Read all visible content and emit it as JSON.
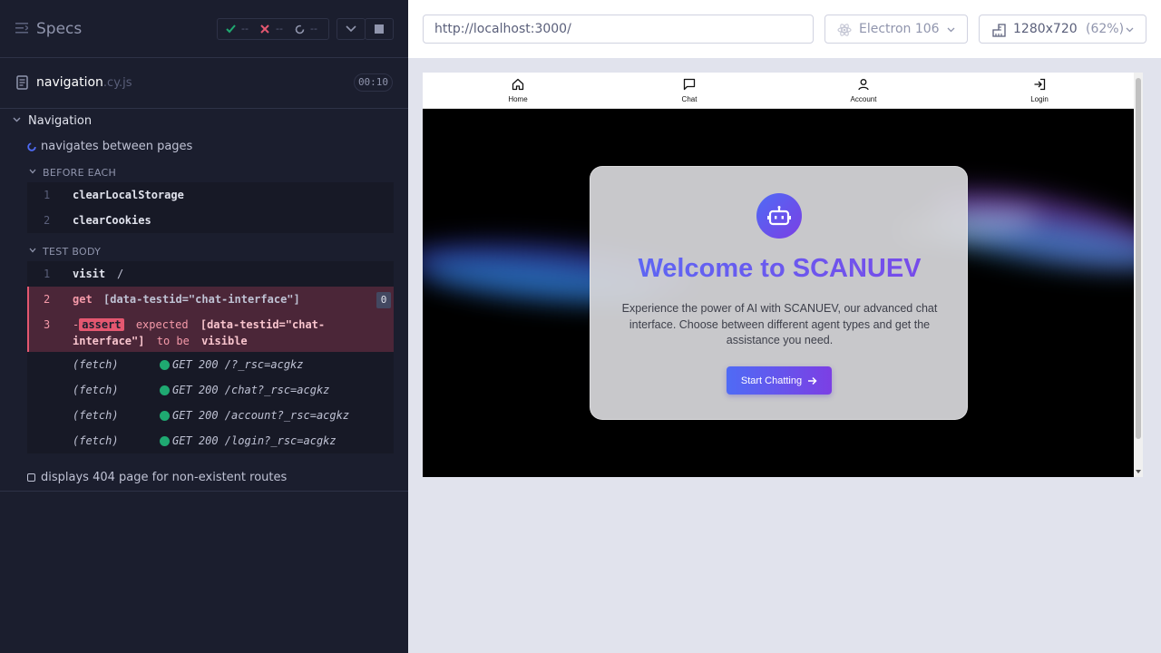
{
  "reporter": {
    "header": {
      "title": "Specs"
    },
    "stats": {
      "passed": "--",
      "failed": "--",
      "pending": "--"
    },
    "file": {
      "name": "navigation",
      "ext": ".cy.js",
      "duration": "00:10"
    },
    "suite": {
      "title": "Navigation"
    },
    "tests": [
      {
        "title": "navigates between pages",
        "state": "running"
      },
      {
        "title": "displays 404 page for non-existent routes",
        "state": "pending"
      }
    ],
    "hooks": {
      "before_each": "BEFORE EACH",
      "test_body": "TEST BODY"
    },
    "before_each_commands": [
      {
        "num": "1",
        "name": "clearLocalStorage",
        "message": ""
      },
      {
        "num": "2",
        "name": "clearCookies",
        "message": ""
      }
    ],
    "test_body_commands": [
      {
        "num": "1",
        "name": "visit",
        "message": "/"
      },
      {
        "num": "2",
        "name": "get",
        "message": "[data-testid=\"chat-interface\"]",
        "count": "0"
      },
      {
        "num": "3",
        "prefix": "-",
        "name": "assert",
        "expected": "expected",
        "selector_1": "[data-testid=\"chat-",
        "selector_2": "interface\"]",
        "to_be": "to be",
        "visible": "visible"
      }
    ],
    "fetch_rows": [
      {
        "tag": "(fetch)",
        "text": "GET 200 /?_rsc=acgkz"
      },
      {
        "tag": "(fetch)",
        "text": "GET 200 /chat?_rsc=acgkz"
      },
      {
        "tag": "(fetch)",
        "text": "GET 200 /account?_rsc=acgkz"
      },
      {
        "tag": "(fetch)",
        "text": "GET 200 /login?_rsc=acgkz"
      }
    ]
  },
  "topbar": {
    "url": "http://localhost:3000/",
    "browser": "Electron 106",
    "viewport": "1280x720",
    "scale": "(62%)"
  },
  "app": {
    "nav": [
      {
        "label": "Home",
        "icon": "home-icon"
      },
      {
        "label": "Chat",
        "icon": "chat-icon"
      },
      {
        "label": "Account",
        "icon": "account-icon"
      },
      {
        "label": "Login",
        "icon": "login-icon"
      }
    ],
    "hero": {
      "title": "Welcome to SCANUEV",
      "description": "Experience the power of AI with SCANUEV, our advanced chat interface. Choose between different agent types and get the assistance you need.",
      "cta": "Start Chatting"
    }
  },
  "colors": {
    "reporter_bg": "#1b1e2e",
    "fail": "#e45770",
    "success": "#1fa971",
    "accent_from": "#4f6bf5",
    "accent_to": "#7c3fe4"
  }
}
